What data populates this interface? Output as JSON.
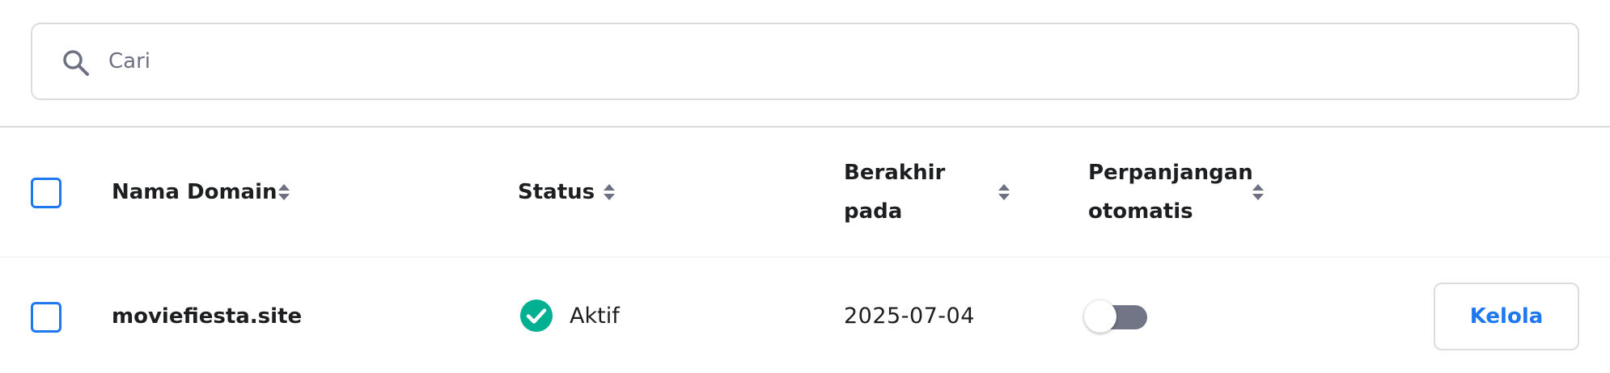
{
  "search": {
    "placeholder": "Cari",
    "icon": "search-icon"
  },
  "table": {
    "headers": {
      "domain": "Nama Domain",
      "status": "Status",
      "expiry_line1": "Berakhir",
      "expiry_line2": "pada",
      "auto_line1": "Perpanjangan",
      "auto_line2": "otomatis"
    },
    "rows": [
      {
        "domain": "moviefiesta.site",
        "status": "Aktif",
        "expiry": "2025-07-04",
        "auto_renew": false,
        "action": "Kelola"
      }
    ]
  },
  "colors": {
    "accent": "#1e78f0",
    "success": "#00b090",
    "toggle_off": "#727586",
    "border": "#dadce0"
  }
}
